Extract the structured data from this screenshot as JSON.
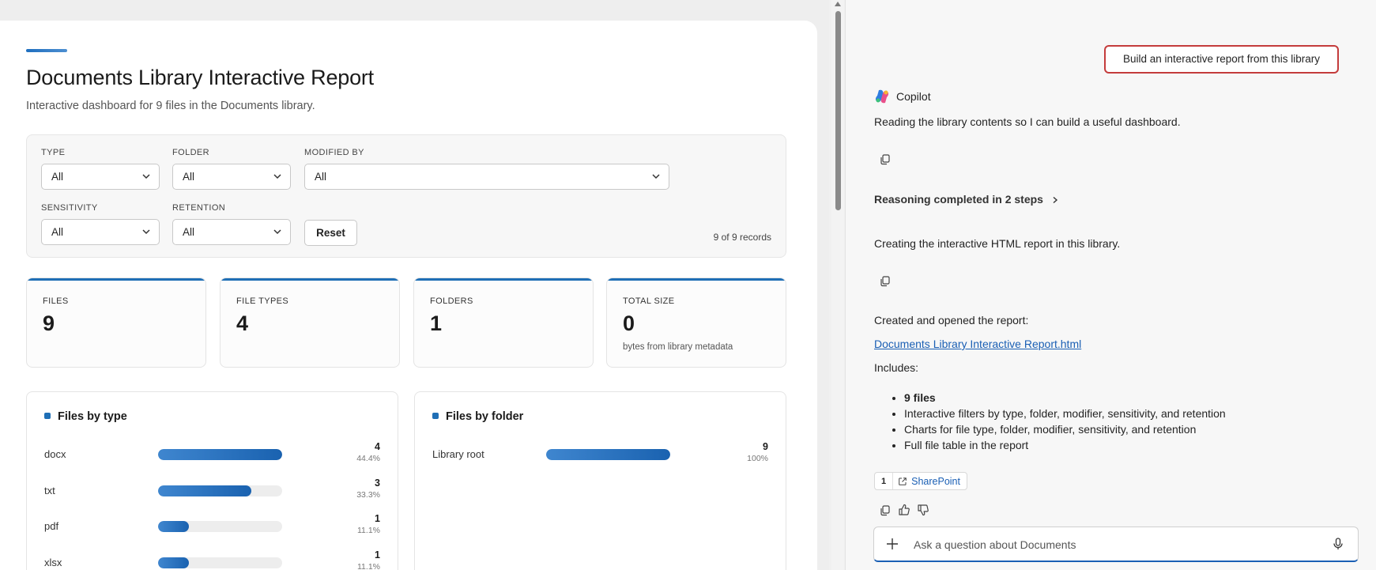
{
  "report": {
    "title": "Documents Library Interactive Report",
    "subtitle": "Interactive dashboard for 9 files in the Documents library.",
    "filters": {
      "type": {
        "label": "TYPE",
        "value": "All"
      },
      "folder": {
        "label": "FOLDER",
        "value": "All"
      },
      "modified_by": {
        "label": "MODIFIED BY",
        "value": "All"
      },
      "sensitivity": {
        "label": "SENSITIVITY",
        "value": "All"
      },
      "retention": {
        "label": "RETENTION",
        "value": "All"
      },
      "reset_label": "Reset",
      "record_count": "9 of 9 records"
    },
    "kpis": [
      {
        "label": "FILES",
        "value": "9",
        "note": ""
      },
      {
        "label": "FILE TYPES",
        "value": "4",
        "note": ""
      },
      {
        "label": "FOLDERS",
        "value": "1",
        "note": ""
      },
      {
        "label": "TOTAL SIZE",
        "value": "0",
        "note": "bytes from library metadata"
      }
    ],
    "charts": {
      "by_type": {
        "title": "Files by type",
        "rows": [
          {
            "category": "docx",
            "value": "4",
            "pct": "44.4%",
            "fraction": 1.0
          },
          {
            "category": "txt",
            "value": "3",
            "pct": "33.3%",
            "fraction": 0.75
          },
          {
            "category": "pdf",
            "value": "1",
            "pct": "11.1%",
            "fraction": 0.25
          },
          {
            "category": "xlsx",
            "value": "1",
            "pct": "11.1%",
            "fraction": 0.25
          }
        ]
      },
      "by_folder": {
        "title": "Files by folder",
        "rows": [
          {
            "category": "Library root",
            "value": "9",
            "pct": "100%",
            "fraction": 1.0
          }
        ]
      }
    }
  },
  "copilot": {
    "user_message": "Build an interactive report from this library",
    "assistant_name": "Copilot",
    "msg_reading": "Reading the library contents so I can build a useful dashboard.",
    "reasoning": "Reasoning completed in 2 steps",
    "msg_creating": "Creating the interactive HTML report in this library.",
    "msg_created": "Created and opened the report:",
    "report_link": "Documents Library Interactive Report.html",
    "includes_label": "Includes:",
    "includes": [
      "9 files",
      "Interactive filters by type, folder, modifier, sensitivity, and retention",
      "Charts for file type, folder, modifier, sensitivity, and retention",
      "Full file table in the report"
    ],
    "citation": {
      "number": "1",
      "source": "SharePoint"
    },
    "composer_placeholder": "Ask a question about Documents"
  },
  "colors": {
    "accent": "#1f6fb6",
    "highlight_border": "#c43c3c",
    "link": "#1a5fb4"
  }
}
